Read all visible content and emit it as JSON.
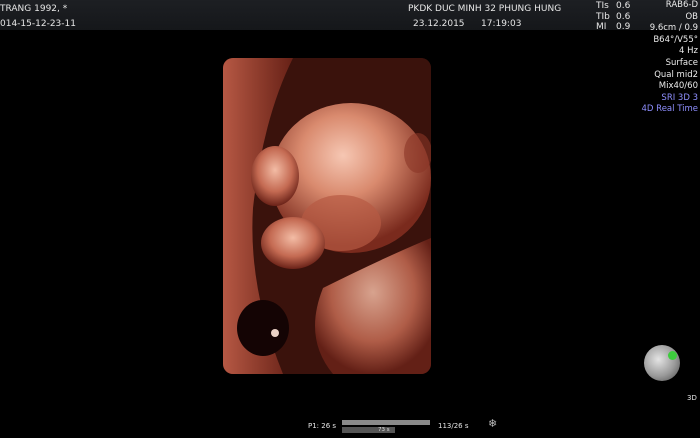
{
  "header": {
    "patient": "TRANG 1992,  *",
    "exam_id": "014-15-12-23-11",
    "clinic": "PKDK DUC MINH 32 PHUNG HUNG",
    "date": "23.12.2015",
    "time": "17:19:03",
    "indices": [
      {
        "label": "TIs",
        "value": "0.6"
      },
      {
        "label": "TIb",
        "value": "0.6"
      },
      {
        "label": "MI",
        "value": "0.9"
      }
    ]
  },
  "params": [
    "RAB6-D",
    "OB",
    "9.6cm / 0.9",
    "B64°/V55°",
    "4 Hz",
    "Surface",
    "Qual mid2",
    "Mix40/60",
    "SRI 3D 3",
    "4D Real Time"
  ],
  "params_highlight": [
    "SRI 3D 3",
    "4D Real Time"
  ],
  "side_label": "3D",
  "cine": {
    "p1": "P1:  26 s",
    "frame_label": "73 s",
    "frames": "113/26 s",
    "progress": 0.6
  },
  "colors": {
    "header_bg": "#1b1d21",
    "params_highlight": "#8f8fff",
    "globe_marker": "#3dcc3d"
  }
}
